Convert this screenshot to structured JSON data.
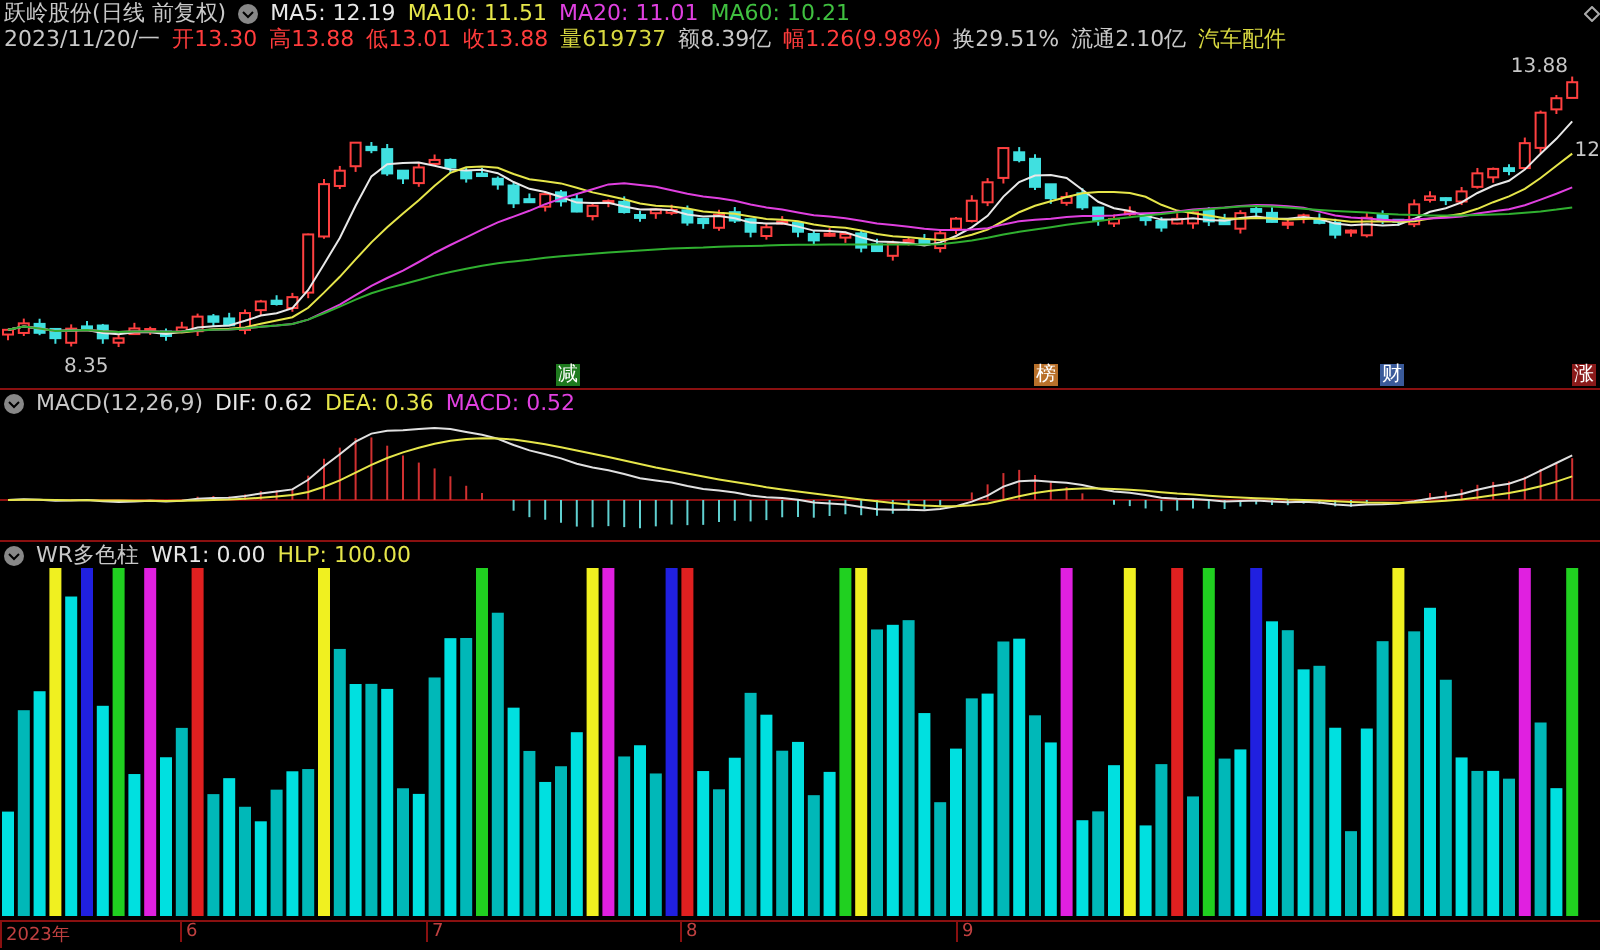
{
  "header": {
    "stock_title": "跃岭股份(日线 前复权)",
    "moving_averages": [
      {
        "text": "MA5: 12.19",
        "color": "#e8e8e8"
      },
      {
        "text": "MA10: 11.51",
        "color": "#e6e64a"
      },
      {
        "text": "MA20: 11.01",
        "color": "#e040e0"
      },
      {
        "text": "MA60: 10.21",
        "color": "#40c040"
      }
    ],
    "date": "2023/11/20/一",
    "quotes": [
      {
        "text": "开13.30",
        "color": "#ff3c3c"
      },
      {
        "text": "高13.88",
        "color": "#ff3c3c"
      },
      {
        "text": "低13.01",
        "color": "#ff3c3c"
      },
      {
        "text": "收13.88",
        "color": "#ff3c3c"
      },
      {
        "text": "量619737",
        "color": "#d8d840"
      },
      {
        "text": "额8.39亿",
        "color": "#c8c8c8"
      },
      {
        "text": "幅1.26(9.98%)",
        "color": "#ff3c3c"
      },
      {
        "text": "换29.51%",
        "color": "#c8c8c8"
      },
      {
        "text": "流通2.10亿",
        "color": "#c8c8c8"
      },
      {
        "text": "汽车配件",
        "color": "#d8d840"
      }
    ]
  },
  "price_panel": {
    "high_label": "13.88",
    "low_label": "8.35",
    "cut_label": "12",
    "tags": [
      {
        "text": "减",
        "color": "#1e7a1e"
      },
      {
        "text": "榜",
        "color": "#b8702a"
      },
      {
        "text": "财",
        "color": "#3a5a9a"
      },
      {
        "text": "涨",
        "color": "#8a1a1a"
      }
    ]
  },
  "macd_panel": {
    "title": "MACD(12,26,9)",
    "values": [
      {
        "text": "DIF: 0.62",
        "color": "#e8e8e8"
      },
      {
        "text": "DEA: 0.36",
        "color": "#e6e64a"
      },
      {
        "text": "MACD: 0.52",
        "color": "#e040e0"
      }
    ]
  },
  "wr_panel": {
    "title": "WR多色柱",
    "values": [
      {
        "text": "WR1: 0.00",
        "color": "#e8e8e8"
      },
      {
        "text": "HLP: 100.00",
        "color": "#e6e64a"
      }
    ]
  },
  "x_axis": [
    "2023年",
    "6",
    "7",
    "8",
    "9"
  ]
}
